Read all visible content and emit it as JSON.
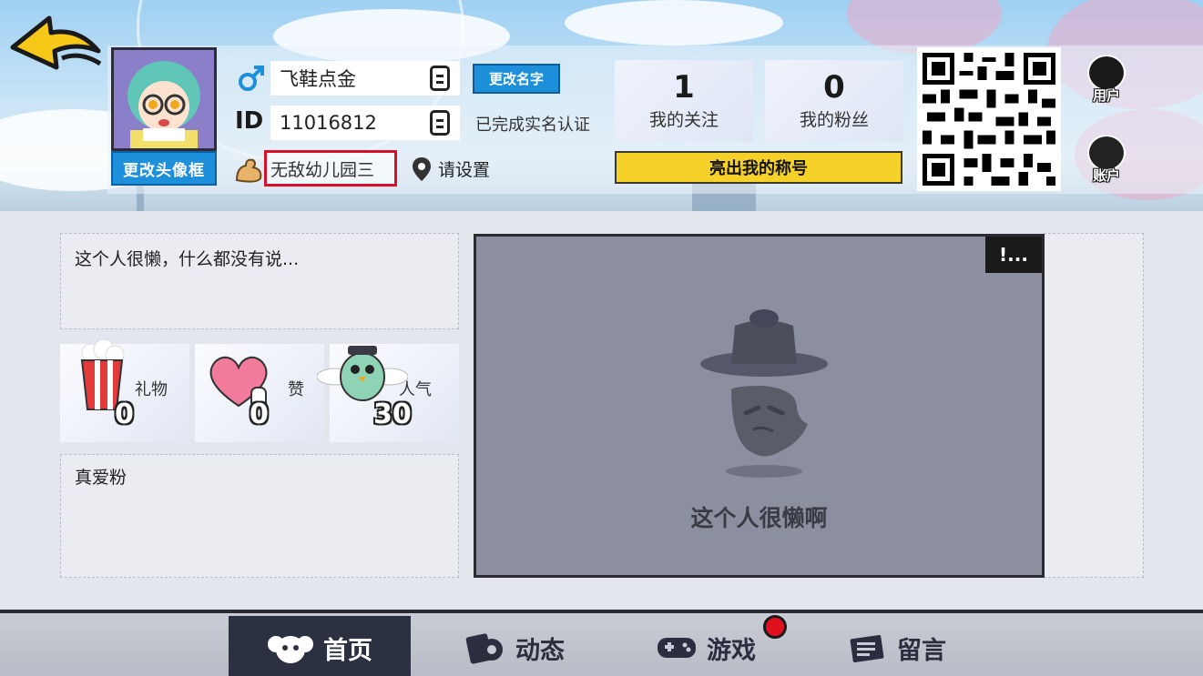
{
  "header": {
    "avatar_button": "更改头像框",
    "nickname": "飞鞋点金",
    "id_label": "ID",
    "id_value": "11016812",
    "rename_button": "更改名字",
    "realname_status": "已完成实名认证",
    "title": "无敌幼儿园三",
    "location": "请设置",
    "show_title_button": "亮出我的称号"
  },
  "stats": {
    "following": {
      "value": "1",
      "label": "我的关注"
    },
    "fans": {
      "value": "0",
      "label": "我的粉丝"
    }
  },
  "side_buttons": {
    "user": "用户",
    "account": "账户"
  },
  "signature": "这个人很懒，什么都没有说...",
  "mini_stats": [
    {
      "label": "礼物",
      "value": "0",
      "icon": "popcorn-icon"
    },
    {
      "label": "赞",
      "value": "0",
      "icon": "heart-hand-icon"
    },
    {
      "label": "人气",
      "value": "30",
      "icon": "bird-icon"
    }
  ],
  "fans_panel_title": "真爱粉",
  "stage": {
    "empty_text": "这个人很懒啊",
    "edit_badge": "!..."
  },
  "nav": {
    "tabs": [
      {
        "label": "首页",
        "icon": "monkey-icon",
        "active": true
      },
      {
        "label": "动态",
        "icon": "cards-icon",
        "active": false
      },
      {
        "label": "游戏",
        "icon": "gamepad-icon",
        "active": false
      },
      {
        "label": "留言",
        "icon": "message-icon",
        "active": false
      }
    ]
  },
  "colors": {
    "accent_blue": "#1e8fdb",
    "accent_yellow": "#f6d12a",
    "highlight_red": "#d8102a",
    "nav_active": "#2c3142"
  }
}
